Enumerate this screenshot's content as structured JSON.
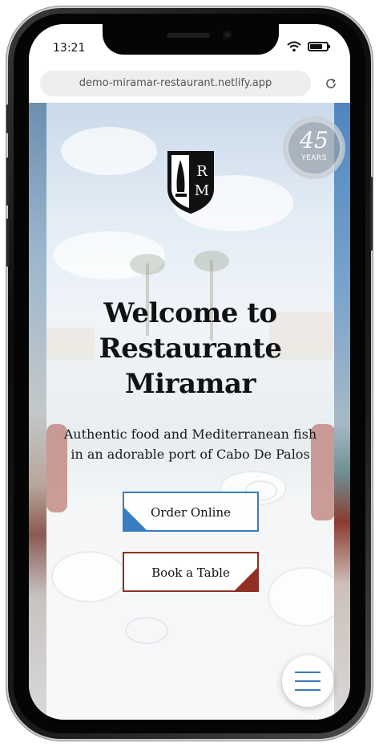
{
  "status_bar": {
    "time": "13:21"
  },
  "browser": {
    "url": "demo-miramar-restaurant.netlify.app"
  },
  "badge": {
    "number": "45",
    "label": "YEARS"
  },
  "logo": {
    "letters": [
      "R",
      "M"
    ]
  },
  "hero": {
    "title_lines": [
      "Welcome to",
      "Restaurante",
      "Miramar"
    ],
    "subtitle_lines": [
      "Authentic food and Mediterranean fish",
      "in an adorable port of Cabo De Palos"
    ]
  },
  "buttons": {
    "order_online": "Order Online",
    "book_table": "Book a Table"
  },
  "colors": {
    "accent_blue": "#3a7cc0",
    "accent_red": "#8f3022"
  },
  "icons": {
    "wifi": "wifi-icon",
    "battery": "battery-icon",
    "reload": "reload-icon",
    "menu": "hamburger-menu-icon"
  }
}
